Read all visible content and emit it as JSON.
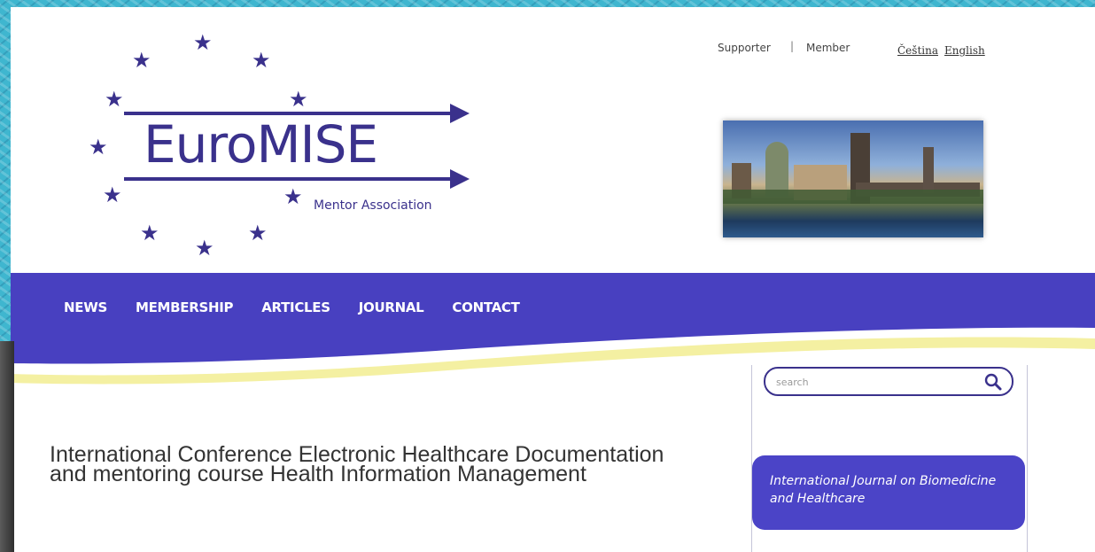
{
  "logo": {
    "title": "EuroMISE",
    "subtitle": "Mentor Association",
    "color": "#3a318c"
  },
  "top_links": {
    "supporter": "Supporter",
    "separator": "|",
    "member": "Member",
    "lang_cz": "Čeština",
    "lang_en": "English"
  },
  "nav": {
    "items": [
      "NEWS",
      "MEMBERSHIP",
      "ARTICLES",
      "JOURNAL",
      "CONTACT"
    ],
    "band_color": "#4840c0",
    "accent_color": "#f4f0a2"
  },
  "main": {
    "headline": "International Conference Electronic Healthcare Documentation and mentoring course Health Information Management"
  },
  "sidebar": {
    "search": {
      "placeholder": "search",
      "icon": "search-icon"
    },
    "journal_banner": "International Journal on Biomedicine and Healthcare"
  }
}
